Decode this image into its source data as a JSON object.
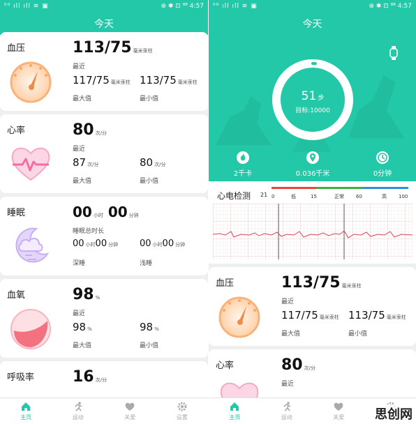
{
  "left": {
    "status": {
      "signal": "⁰⁰ ıll ıll ≋ ▣",
      "right_icons": "⊛ ✱ ⊡ ⁸⁸",
      "time": "4:57"
    },
    "title": "今天",
    "cards": {
      "bp": {
        "title": "血压",
        "value": "113/75",
        "unit": "毫米汞柱",
        "sub": "最近",
        "max": "117/75",
        "max_unit": "毫米汞柱",
        "max_label": "最大值",
        "min": "113/75",
        "min_unit": "毫米汞柱",
        "min_label": "最小值"
      },
      "hr": {
        "title": "心率",
        "value": "80",
        "unit": "次/分",
        "sub": "最近",
        "max": "87",
        "max_unit": "次/分",
        "max_label": "最大值",
        "min": "80",
        "min_unit": "次/分",
        "min_label": "最小值"
      },
      "sleep": {
        "title": "睡眠",
        "h": "00",
        "h_unit": "小时",
        "m": "00",
        "m_unit": "分钟",
        "sub": "睡眠总时长",
        "deep_h": "00",
        "deep_m": "00",
        "deep_label": "深睡",
        "light_h": "00",
        "light_m": "00",
        "light_label": "浅睡"
      },
      "spo2": {
        "title": "血氧",
        "value": "98",
        "unit": "%",
        "sub": "最近",
        "max": "98",
        "max_unit": "%",
        "max_label": "最大值",
        "min": "98",
        "min_unit": "%",
        "min_label": "最小值"
      },
      "resp": {
        "title": "呼吸率",
        "value": "16",
        "unit": "次/分"
      }
    },
    "tabs": [
      {
        "label": "主页"
      },
      {
        "label": "运动"
      },
      {
        "label": "关爱"
      },
      {
        "label": "设置"
      }
    ]
  },
  "right": {
    "status": {
      "signal": "⁰⁰ ıll ıll ≋ ▣",
      "right_icons": "⊛ ✱ ⊡ ⁸⁸",
      "time": "4:57"
    },
    "title": "今天",
    "steps": {
      "value": "51",
      "unit": "步",
      "target": "目标:10000",
      "progress": 0.0051
    },
    "stats": {
      "calories": "2千卡",
      "distance": "0.036千米",
      "duration": "0分钟"
    },
    "ecg": {
      "title": "心电检测",
      "value": "21",
      "scale_labels": [
        "0",
        "低",
        "15",
        "正常",
        "60",
        "高",
        "100"
      ]
    },
    "bp": {
      "title": "血压",
      "value": "113/75",
      "unit": "毫米汞柱",
      "sub": "最近",
      "max": "117/75",
      "max_unit": "毫米汞柱",
      "max_label": "最大值",
      "min": "113/75",
      "min_unit": "毫米汞柱",
      "min_label": "最小值"
    },
    "hr": {
      "title": "心率",
      "value": "80",
      "unit": "次/分",
      "sub": "最近"
    },
    "tabs": [
      {
        "label": "主页"
      },
      {
        "label": "运动"
      },
      {
        "label": "关爱"
      },
      {
        "label": "设置"
      }
    ]
  },
  "colors": {
    "accent": "#22c8a8",
    "low": "#e8453c",
    "normal": "#3cb043",
    "high": "#2f8fd8"
  },
  "watermark": "思创网"
}
